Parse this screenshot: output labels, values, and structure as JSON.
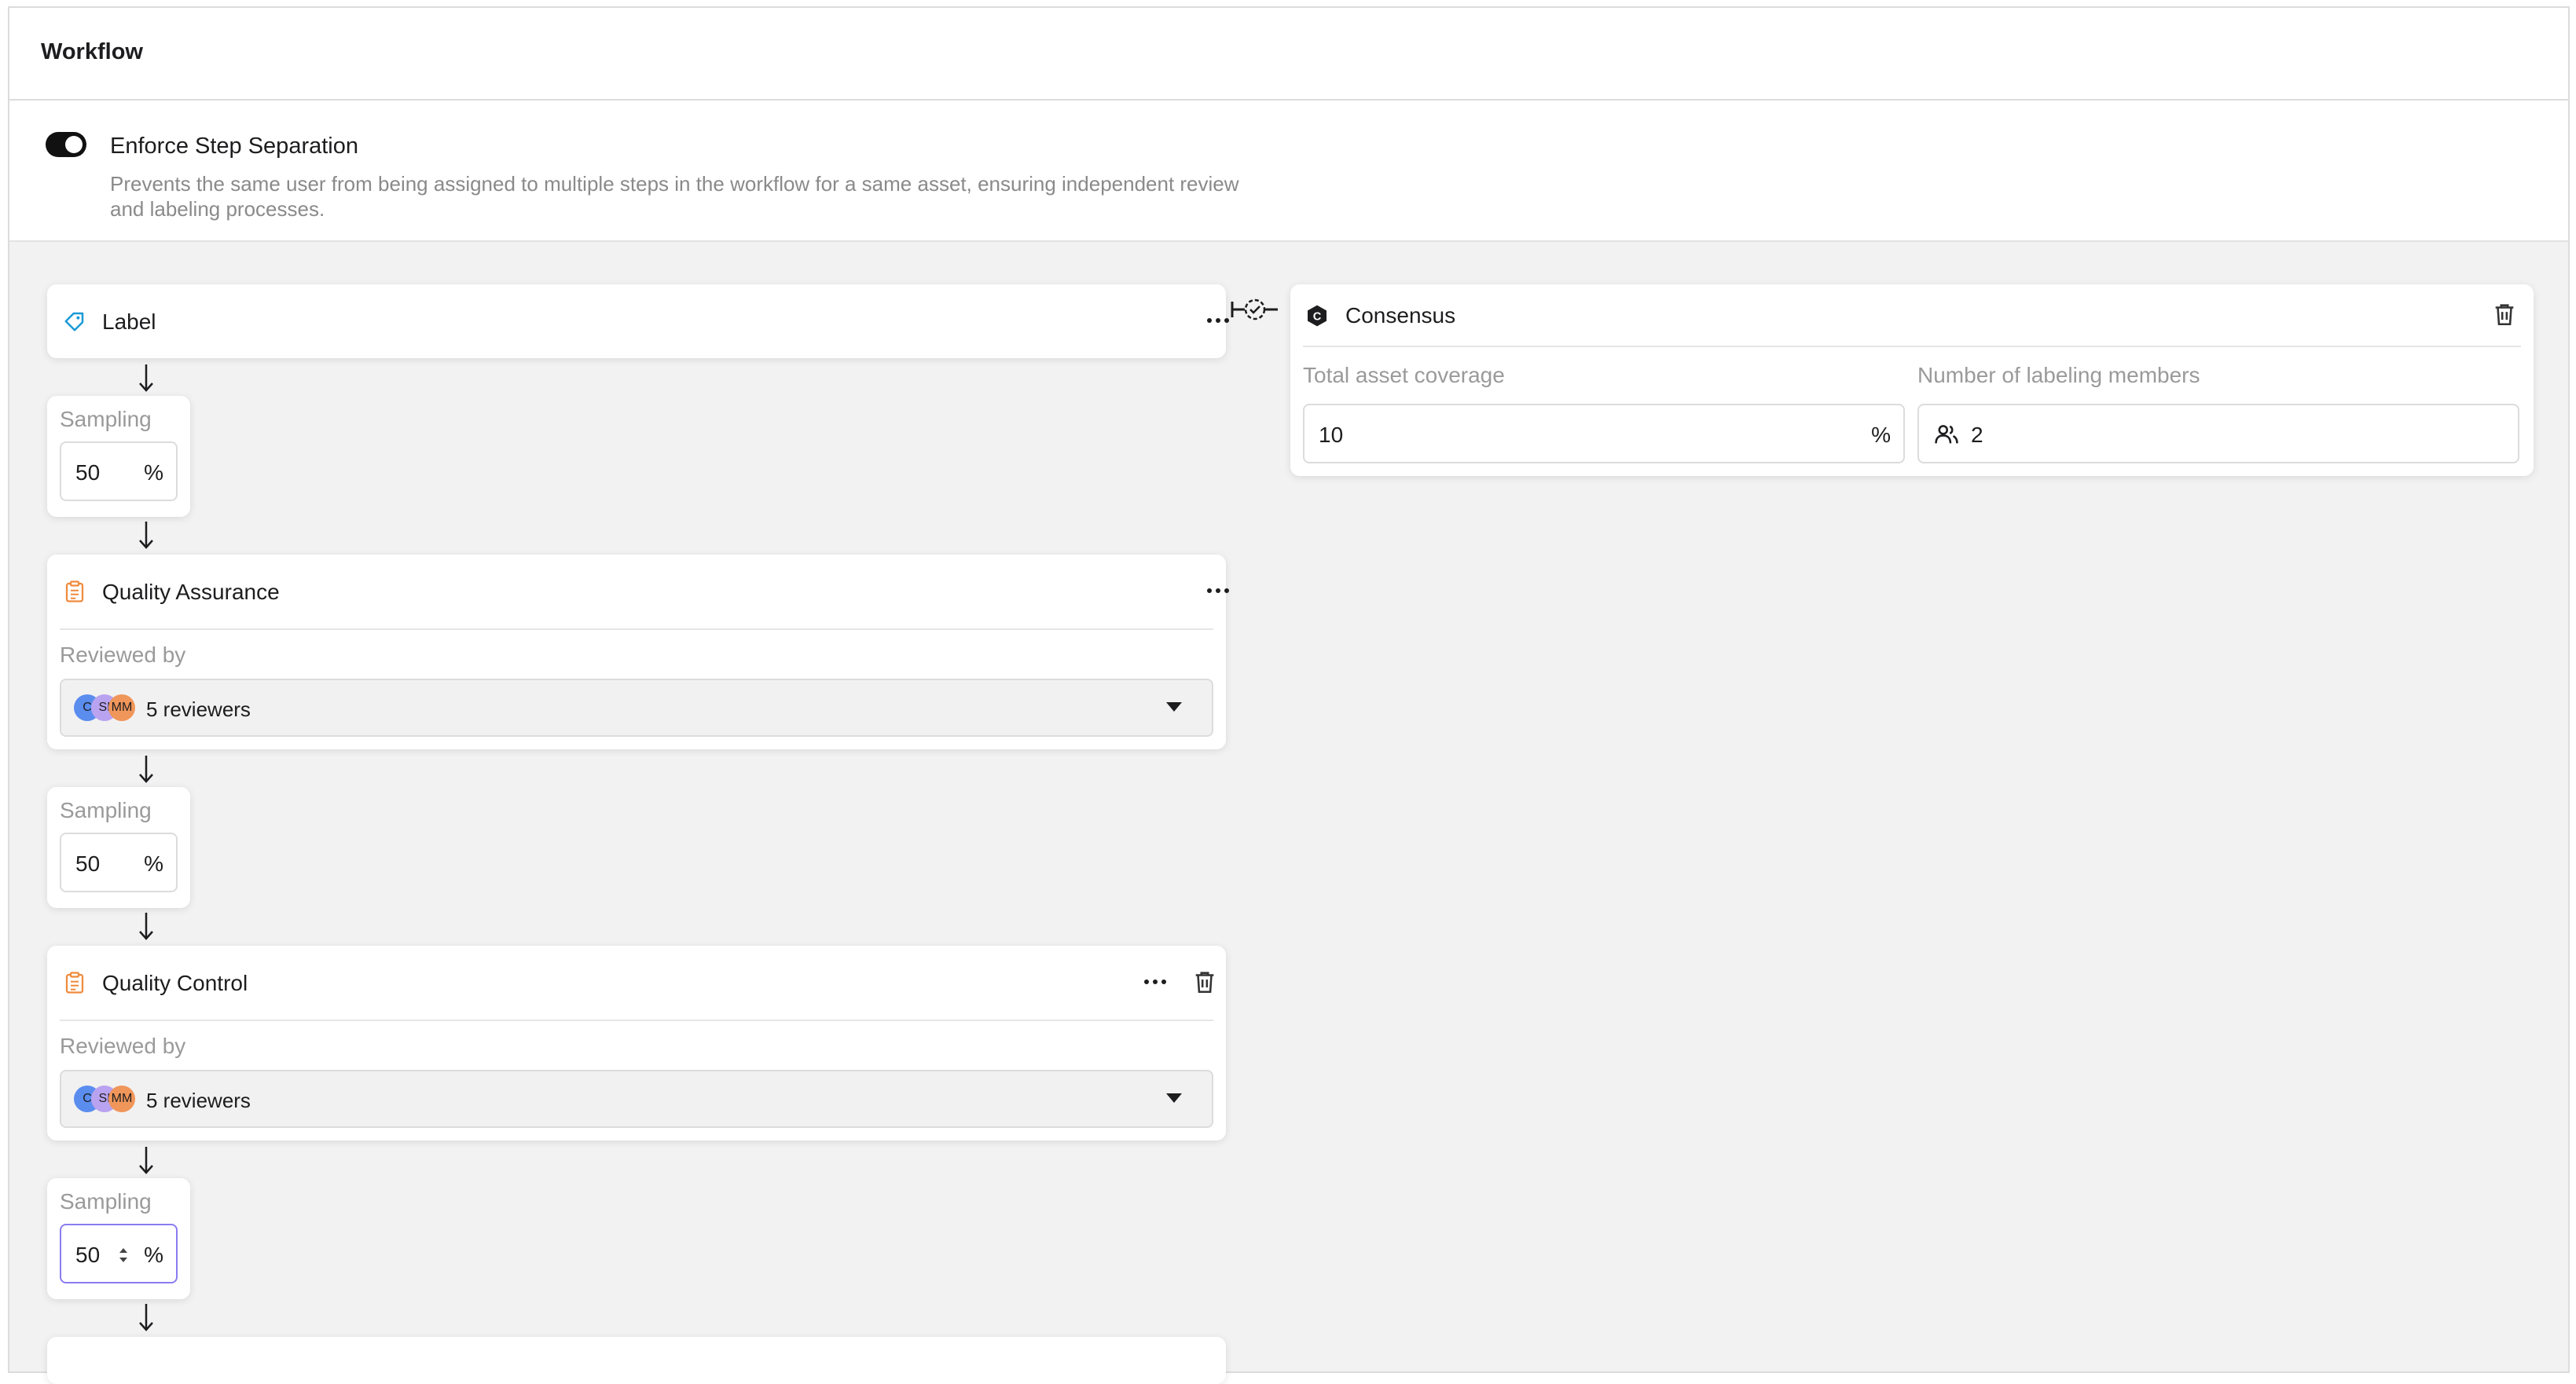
{
  "header": {
    "title": "Workflow"
  },
  "settings": {
    "enforce_label": "Enforce Step Separation",
    "enforce_description": "Prevents the same user from being assigned to multiple steps in the workflow for a same asset, ensuring independent review and labeling processes.",
    "enforce_enabled": true
  },
  "steps": {
    "label": {
      "name": "Label",
      "icon": "tag-icon",
      "color": "#1b9ad6"
    },
    "sampling_1": {
      "label": "Sampling",
      "value": "50",
      "unit": "%"
    },
    "qa": {
      "name": "Quality Assurance",
      "icon": "clipboard-icon",
      "color": "#f08a3c",
      "reviewed_by_label": "Reviewed by",
      "avatars": [
        "C",
        "SI",
        "MM"
      ],
      "reviewers": "5 reviewers"
    },
    "sampling_2": {
      "label": "Sampling",
      "value": "50",
      "unit": "%"
    },
    "qc": {
      "name": "Quality Control",
      "icon": "clipboard-icon",
      "color": "#f08a3c",
      "reviewed_by_label": "Reviewed by",
      "avatars": [
        "C",
        "SI",
        "MM"
      ],
      "reviewers": "5 reviewers"
    },
    "sampling_3": {
      "label": "Sampling",
      "value": "50",
      "unit": "%"
    }
  },
  "consensus": {
    "name": "Consensus",
    "icon": "hexagon-c-icon",
    "coverage_label": "Total asset coverage",
    "coverage_value": "10",
    "coverage_unit": "%",
    "members_label": "Number of labeling members",
    "members_value": "2"
  },
  "avatar_colors": [
    "#5b8def",
    "#b9a3f0",
    "#f0965a"
  ]
}
